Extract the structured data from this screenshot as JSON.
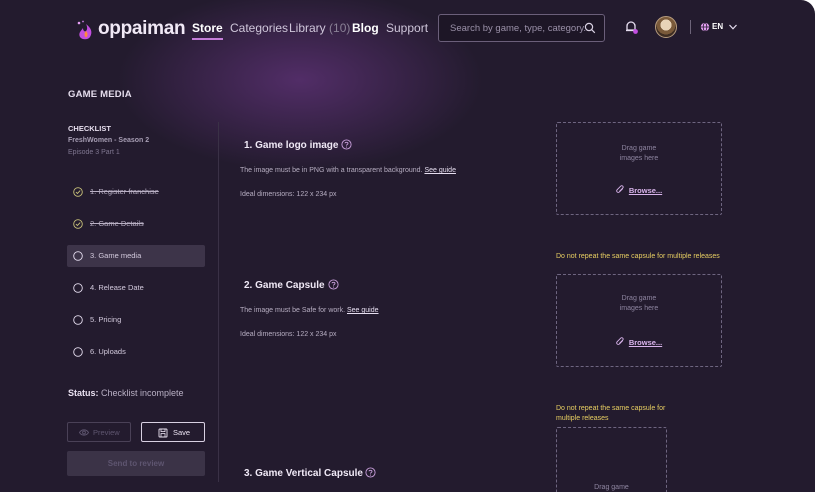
{
  "header": {
    "logo_text": "oppaiman",
    "nav": {
      "store": "Store",
      "categories": "Categories",
      "library": "Library",
      "library_count": "(10)",
      "blog": "Blog",
      "support": "Support"
    },
    "search_placeholder": "Search by game, type, category...",
    "language": "EN"
  },
  "page": {
    "title": "GAME MEDIA"
  },
  "checklist": {
    "title": "CHECKLIST",
    "game": "FreshWomen -  Season 2",
    "episode": "Episode 3 Part 1",
    "steps": [
      {
        "label": "1. Register franchise",
        "status": "done"
      },
      {
        "label": "2. Game Details",
        "status": "done"
      },
      {
        "label": "3. Game media",
        "status": "current"
      },
      {
        "label": "4. Release Date",
        "status": "pending"
      },
      {
        "label": "5. Pricing",
        "status": "pending"
      },
      {
        "label": "6. Uploads",
        "status": "pending"
      }
    ],
    "status_label": "Status:",
    "status_value": "Checklist incomplete",
    "preview_label": "Preview",
    "save_label": "Save",
    "review_label": "Send to review"
  },
  "sections": {
    "logo": {
      "title": "1. Game logo image",
      "desc": "The image must be in PNG with a transparent background.",
      "guide": "See guide",
      "dims": "Ideal dimensions: 122 x 234 px",
      "drop_line1": "Drag game",
      "drop_line2": "images here",
      "browse": "Browse..."
    },
    "capsule": {
      "title": "2. Game Capsule",
      "desc": "The image must be Safe for work.",
      "guide": "See guide",
      "dims": "Ideal dimensions: 122 x 234 px",
      "warning": "Do not repeat the same capsule for multiple releases",
      "drop_line1": "Drag game",
      "drop_line2": "images here",
      "browse": "Browse..."
    },
    "vertical": {
      "title": "3. Game Vertical Capsule",
      "warning": "Do not repeat the same capsule for multiple releases",
      "drop_line1": "Drag game"
    }
  },
  "colors": {
    "background": "#231b2e",
    "accent": "#c47dd8",
    "warning": "#e8cf62",
    "done_check": "#c9c27a"
  }
}
